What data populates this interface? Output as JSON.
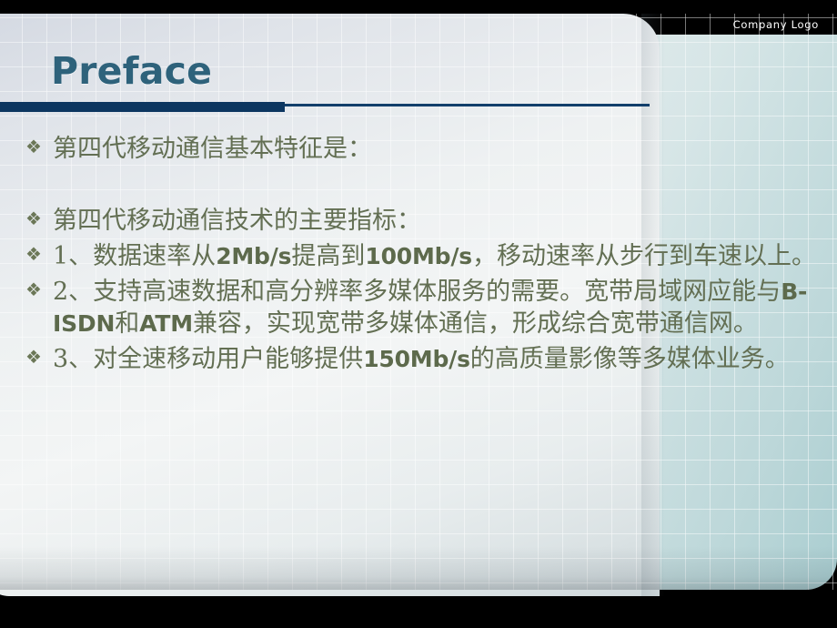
{
  "slide": {
    "logo_text": "Company Logo",
    "title": "Preface",
    "bullet_mark": "❖"
  },
  "bullets": [
    {
      "id": "bullet-1",
      "segments": [
        {
          "text": "第四代移动通信基本特征是：",
          "bold": false
        }
      ]
    },
    {
      "id": "bullet-2",
      "segments": [
        {
          "text": "第四代移动通信技术的主要指标：",
          "bold": false
        }
      ]
    },
    {
      "id": "bullet-3",
      "segments": [
        {
          "text": "1、数据速率从",
          "bold": false
        },
        {
          "text": "2Mb/s",
          "bold": true
        },
        {
          "text": "提高到",
          "bold": false
        },
        {
          "text": "100Mb/s",
          "bold": true
        },
        {
          "text": "，移动速率从步行到车速以上。",
          "bold": false
        }
      ]
    },
    {
      "id": "bullet-4",
      "segments": [
        {
          "text": "2、支持高速数据和高分辨率多媒体服务的需要。宽带局域网应能与",
          "bold": false
        },
        {
          "text": "B-ISDN",
          "bold": true
        },
        {
          "text": "和",
          "bold": false
        },
        {
          "text": "ATM",
          "bold": true
        },
        {
          "text": "兼容，实现宽带多媒体通信，形成综合宽带通信网。",
          "bold": false
        }
      ]
    },
    {
      "id": "bullet-5",
      "segments": [
        {
          "text": "3、对全速移动用户能够提供",
          "bold": false
        },
        {
          "text": "150Mb/s",
          "bold": true
        },
        {
          "text": "的高质量影像等多媒体业务。",
          "bold": false
        }
      ]
    }
  ],
  "colors": {
    "title": "#2e627b",
    "rule": "#0c3660",
    "body_text": "#636f53",
    "logo_text": "#ffffff",
    "background": "#000000"
  }
}
